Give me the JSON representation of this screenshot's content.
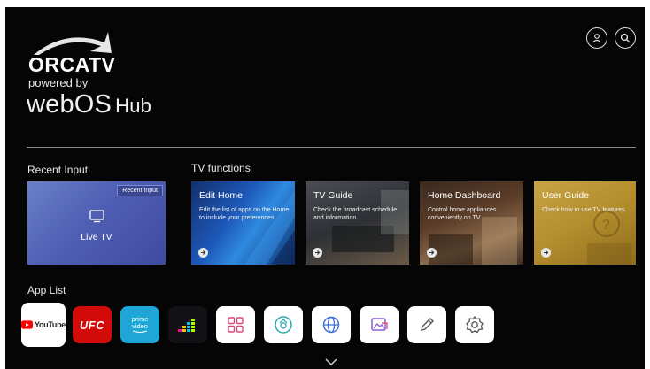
{
  "brand": {
    "name": "ORCATV",
    "powered": "powered by",
    "webos": "webOS",
    "hub": "Hub"
  },
  "header_icons": [
    "user-icon",
    "search-icon"
  ],
  "recent_input": {
    "section_label": "Recent Input",
    "badge": "Recent Input",
    "label": "Live TV"
  },
  "tv_functions": {
    "section_label": "TV functions",
    "cards": [
      {
        "title": "Edit Home",
        "desc": "Edit the list of apps on the Home to include your preferences."
      },
      {
        "title": "TV Guide",
        "desc": "Check the broadcast schedule and information."
      },
      {
        "title": "Home Dashboard",
        "desc": "Control home appliances conveniently on TV."
      },
      {
        "title": "User Guide",
        "desc": "Check how to use TV features."
      }
    ]
  },
  "app_list": {
    "section_label": "App List",
    "apps": [
      {
        "name": "YouTube",
        "label": "YouTube"
      },
      {
        "name": "UFC",
        "label": "UFC"
      },
      {
        "name": "Prime Video",
        "label_top": "prime",
        "label_bottom": "video"
      },
      {
        "name": "Deezer",
        "icon": "deezer-icon"
      },
      {
        "name": "Apps",
        "icon": "apps-grid-icon"
      },
      {
        "name": "Screen Share",
        "icon": "screen-share-icon"
      },
      {
        "name": "Web Browser",
        "icon": "globe-icon"
      },
      {
        "name": "Gallery",
        "icon": "gallery-icon"
      },
      {
        "name": "Edit",
        "icon": "pencil-icon"
      },
      {
        "name": "Settings",
        "icon": "gear-icon"
      }
    ]
  },
  "colors": {
    "youtube_red": "#ff0000",
    "ufc_red": "#d20a0a",
    "prime_blue": "#1ea7d6",
    "accent_icon": "#4b6fd8"
  }
}
